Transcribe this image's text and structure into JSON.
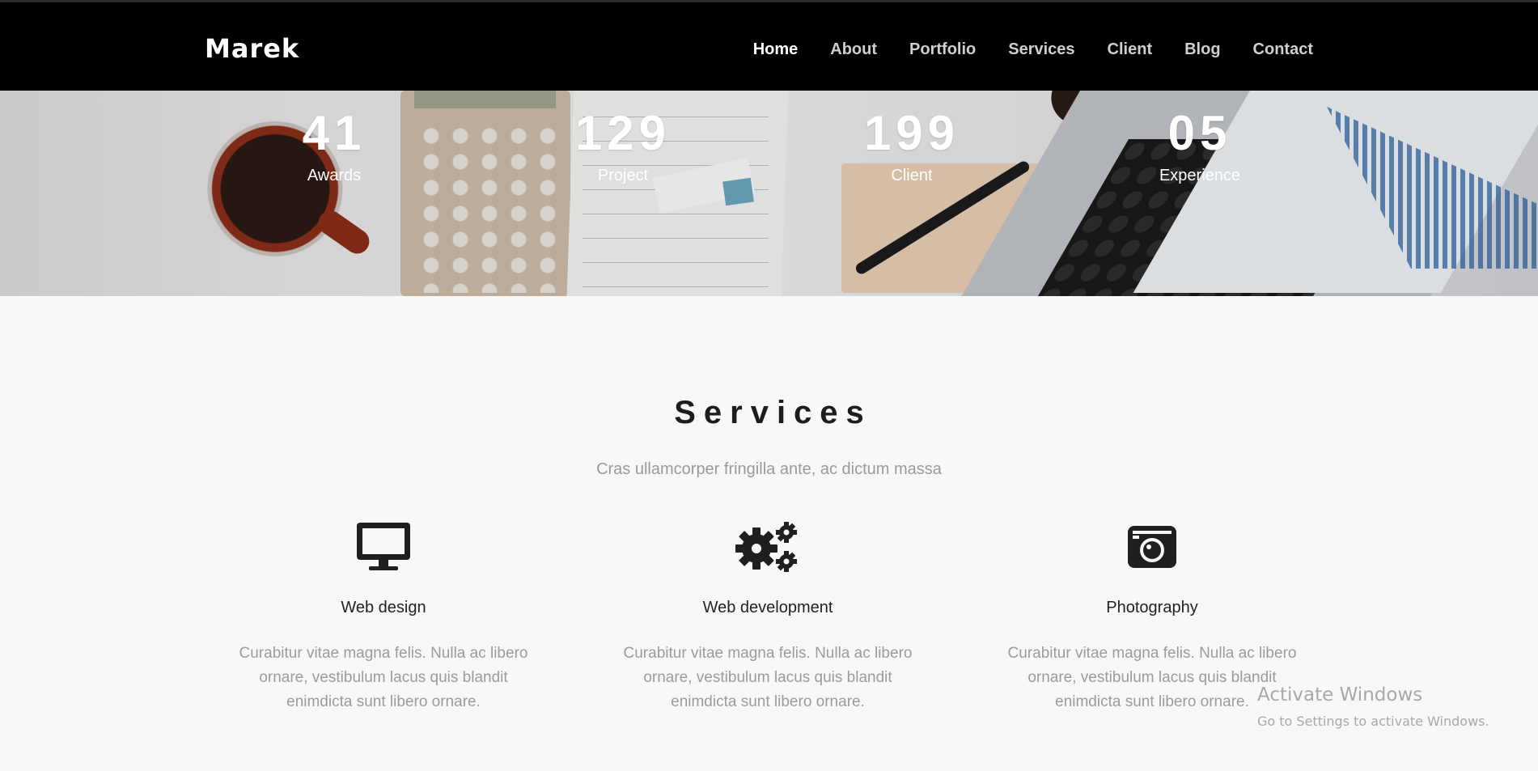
{
  "brand": {
    "name": "Marek"
  },
  "nav": {
    "items": [
      {
        "label": "Home",
        "active": true
      },
      {
        "label": "About"
      },
      {
        "label": "Portfolio"
      },
      {
        "label": "Services"
      },
      {
        "label": "Client"
      },
      {
        "label": "Blog"
      },
      {
        "label": "Contact"
      }
    ]
  },
  "stats": [
    {
      "value": "41",
      "label": "Awards"
    },
    {
      "value": "129",
      "label": "Project"
    },
    {
      "value": "199",
      "label": "Client"
    },
    {
      "value": "05",
      "label": "Experience"
    }
  ],
  "services": {
    "title": "Services",
    "subtitle": "Cras ullamcorper fringilla ante, ac dictum massa",
    "items": [
      {
        "icon": "monitor-icon",
        "title": "Web design",
        "description": "Curabitur vitae magna felis. Nulla ac libero ornare, vestibulum lacus quis blandit enimdicta sunt libero ornare."
      },
      {
        "icon": "gears-icon",
        "title": "Web development",
        "description": "Curabitur vitae magna felis. Nulla ac libero ornare, vestibulum lacus quis blandit enimdicta sunt libero ornare."
      },
      {
        "icon": "camera-icon",
        "title": "Photography",
        "description": "Curabitur vitae magna felis. Nulla ac libero ornare, vestibulum lacus quis blandit enimdicta sunt libero ornare."
      }
    ]
  },
  "watermark": {
    "line1": "Activate Windows",
    "line2": "Go to Settings to activate Windows."
  },
  "colors": {
    "nav_bg": "#000000",
    "page_bg": "#f7f8fa",
    "text_dark": "#1d1d1d",
    "text_muted": "#9b9b9b"
  }
}
